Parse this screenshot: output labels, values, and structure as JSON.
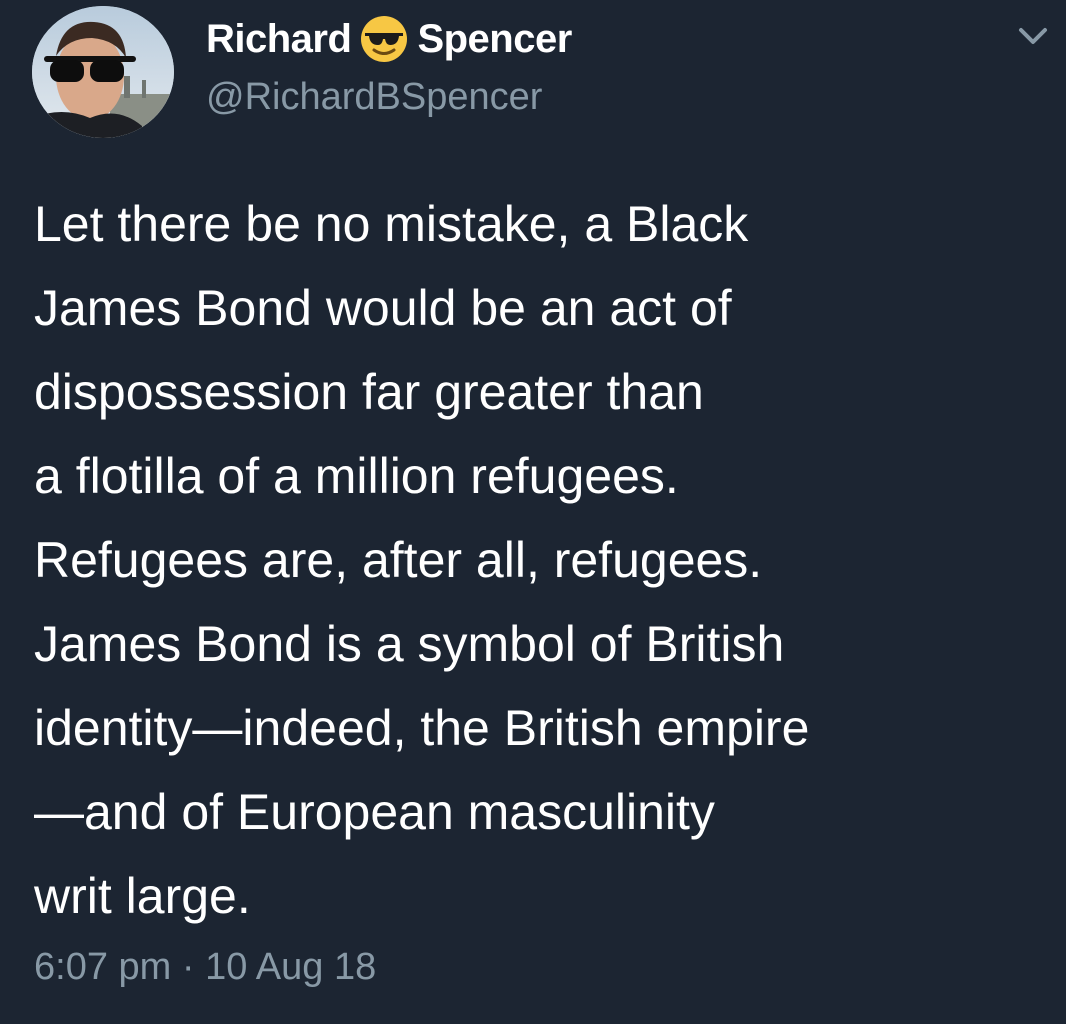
{
  "tweet": {
    "author": {
      "name_first": "Richard",
      "name_emoji": "smiling-face-with-sunglasses",
      "name_last": "Spencer",
      "handle": "@RichardBSpencer"
    },
    "body_lines": [
      "Let there be no mistake, a Black",
      "James Bond would be an act of",
      "dispossession far greater than",
      "a flotilla of a million refugees.",
      "Refugees are, after all, refugees.",
      "James Bond is a symbol of British",
      "identity—indeed, the British empire",
      "—and of European masculinity",
      "writ large."
    ],
    "timestamp": "6:07 pm · 10 Aug 18",
    "menu_icon": "chevron-down-icon"
  },
  "colors": {
    "background": "#1c2532",
    "primary_text": "#ffffff",
    "secondary_text": "#8899a6"
  }
}
